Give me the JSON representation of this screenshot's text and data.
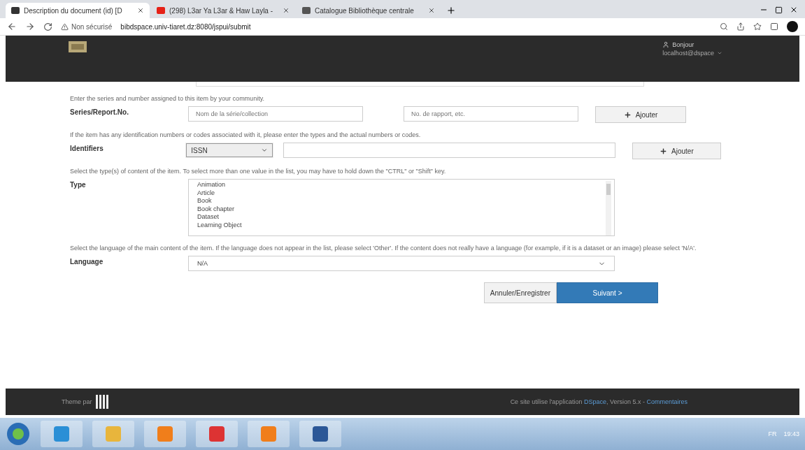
{
  "browser": {
    "tabs": [
      {
        "title": "Description du document (id) [D",
        "selected": true
      },
      {
        "title": "(298) L3ar Ya L3ar & Haw Layla -",
        "selected": false
      },
      {
        "title": "Catalogue Bibliothèque centrale",
        "selected": false
      }
    ],
    "security": "Non sécurisé",
    "url": "bibdspace.univ-tiaret.dz:8080/jspui/submit"
  },
  "navbar": {
    "greeting": "Bonjour",
    "user": "localhost@dspace"
  },
  "form": {
    "fields": [
      {
        "kind": "pair",
        "hint": "Enter the series and number assigned to this item by your community.",
        "label": "Series/Report.No.",
        "placeholder": "Nom de la série/collection",
        "placeholder_2": "No. de rapport, etc.",
        "button": "Ajouter"
      },
      {
        "kind": "typed",
        "hint": "If the item has any identification numbers or codes associated with it, please enter the types and the actual numbers or codes.",
        "label": "Identifiers",
        "select": "ISSN",
        "button": "Ajouter"
      },
      {
        "kind": "list",
        "hint": "Select the type(s) of content of the item. To select more than one value in the list, you may have to hold down the \"CTRL\" or \"Shift\" key.",
        "label": "Type",
        "options": [
          "Animation",
          "Article",
          "Book",
          "Book chapter",
          "Dataset",
          "Learning Object"
        ]
      },
      {
        "kind": "select",
        "hint": "Select the language of the main content of the item. If the language does not appear in the list, please select 'Other'. If the content does not really have a language (for example, if it is a dataset or an image) please select 'N/A'.",
        "label": "Language",
        "select": "N/A"
      }
    ],
    "cancel": "Annuler/Enregistrer",
    "next": "Suivant >"
  },
  "footer": {
    "theme": "Theme par",
    "text": "Ce site utilise l'application ",
    "link": "DSpace",
    "version": ", Version 5.x - ",
    "feedback": "Commentaires"
  },
  "taskbar": {
    "lang": "FR",
    "time": "19:43"
  }
}
